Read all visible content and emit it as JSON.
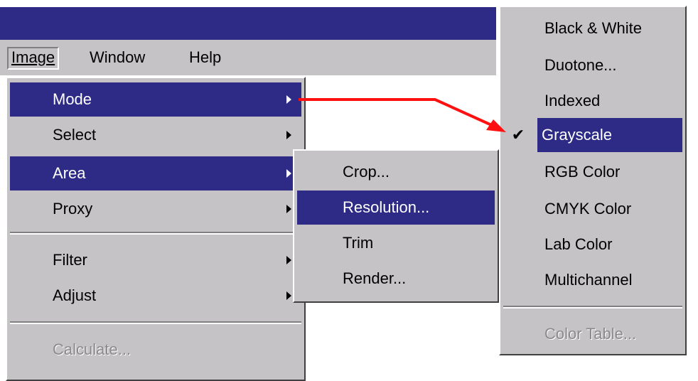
{
  "menubar": {
    "items": [
      {
        "label": "Image",
        "active": true
      },
      {
        "label": "Window",
        "active": false
      },
      {
        "label": "Help",
        "active": false
      }
    ]
  },
  "image_menu": {
    "items": [
      {
        "label": "Mode",
        "highlighted": true,
        "submenu": true
      },
      {
        "label": "Select",
        "highlighted": false,
        "submenu": true
      },
      {
        "label": "Area",
        "highlighted": true,
        "submenu": true
      },
      {
        "label": "Proxy",
        "highlighted": false,
        "submenu": true
      },
      {
        "label": "Filter",
        "highlighted": false,
        "submenu": true
      },
      {
        "label": "Adjust",
        "highlighted": false,
        "submenu": true
      },
      {
        "label": "Calculate...",
        "highlighted": false,
        "disabled": true
      }
    ]
  },
  "area_menu": {
    "items": [
      {
        "label": "Crop..."
      },
      {
        "label": "Resolution...",
        "highlighted": true
      },
      {
        "label": "Trim"
      },
      {
        "label": "Render..."
      }
    ]
  },
  "mode_menu": {
    "items": [
      {
        "label": "Black & White"
      },
      {
        "label": "Duotone..."
      },
      {
        "label": "Indexed"
      },
      {
        "label": "Grayscale",
        "highlighted": true,
        "checked": true
      },
      {
        "label": "RGB Color"
      },
      {
        "label": "CMYK Color"
      },
      {
        "label": "Lab Color"
      },
      {
        "label": "Multichannel"
      },
      {
        "label": "Color Table...",
        "disabled": true
      }
    ],
    "check_glyph": "✔"
  },
  "colors": {
    "highlight": "#2d2b86",
    "menu_bg": "#c6c3c6",
    "arrow": "#ff1010"
  }
}
